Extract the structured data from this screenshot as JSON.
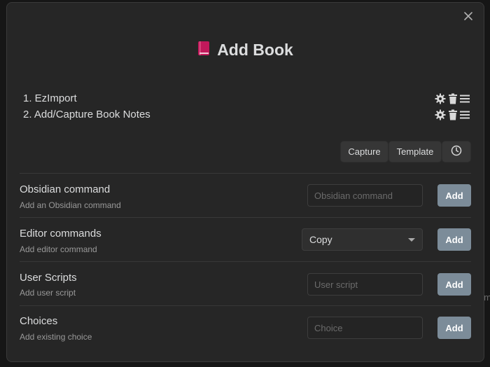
{
  "background": {
    "edge_text": "m"
  },
  "modal": {
    "title": "Add Book",
    "title_icon": "book-icon"
  },
  "steps": [
    {
      "label": "1. EzImport"
    },
    {
      "label": "2. Add/Capture Book Notes"
    }
  ],
  "step_action_icons": [
    "gear-icon",
    "trash-icon",
    "menu-icon"
  ],
  "choice_buttons": {
    "capture": "Capture",
    "template": "Template",
    "history_icon": "clock-icon"
  },
  "sections": {
    "obsidian": {
      "title": "Obsidian command",
      "description": "Add an Obsidian command",
      "placeholder": "Obsidian command",
      "button": "Add"
    },
    "editor": {
      "title": "Editor commands",
      "description": "Add editor command",
      "selected": "Copy",
      "button": "Add"
    },
    "scripts": {
      "title": "User Scripts",
      "description": "Add user script",
      "placeholder": "User script",
      "button": "Add"
    },
    "choices": {
      "title": "Choices",
      "description": "Add existing choice",
      "placeholder": "Choice",
      "button": "Add"
    }
  },
  "colors": {
    "modal_bg": "#262626",
    "accent_button": "#7c8c99",
    "book_icon": "#c2185b"
  }
}
